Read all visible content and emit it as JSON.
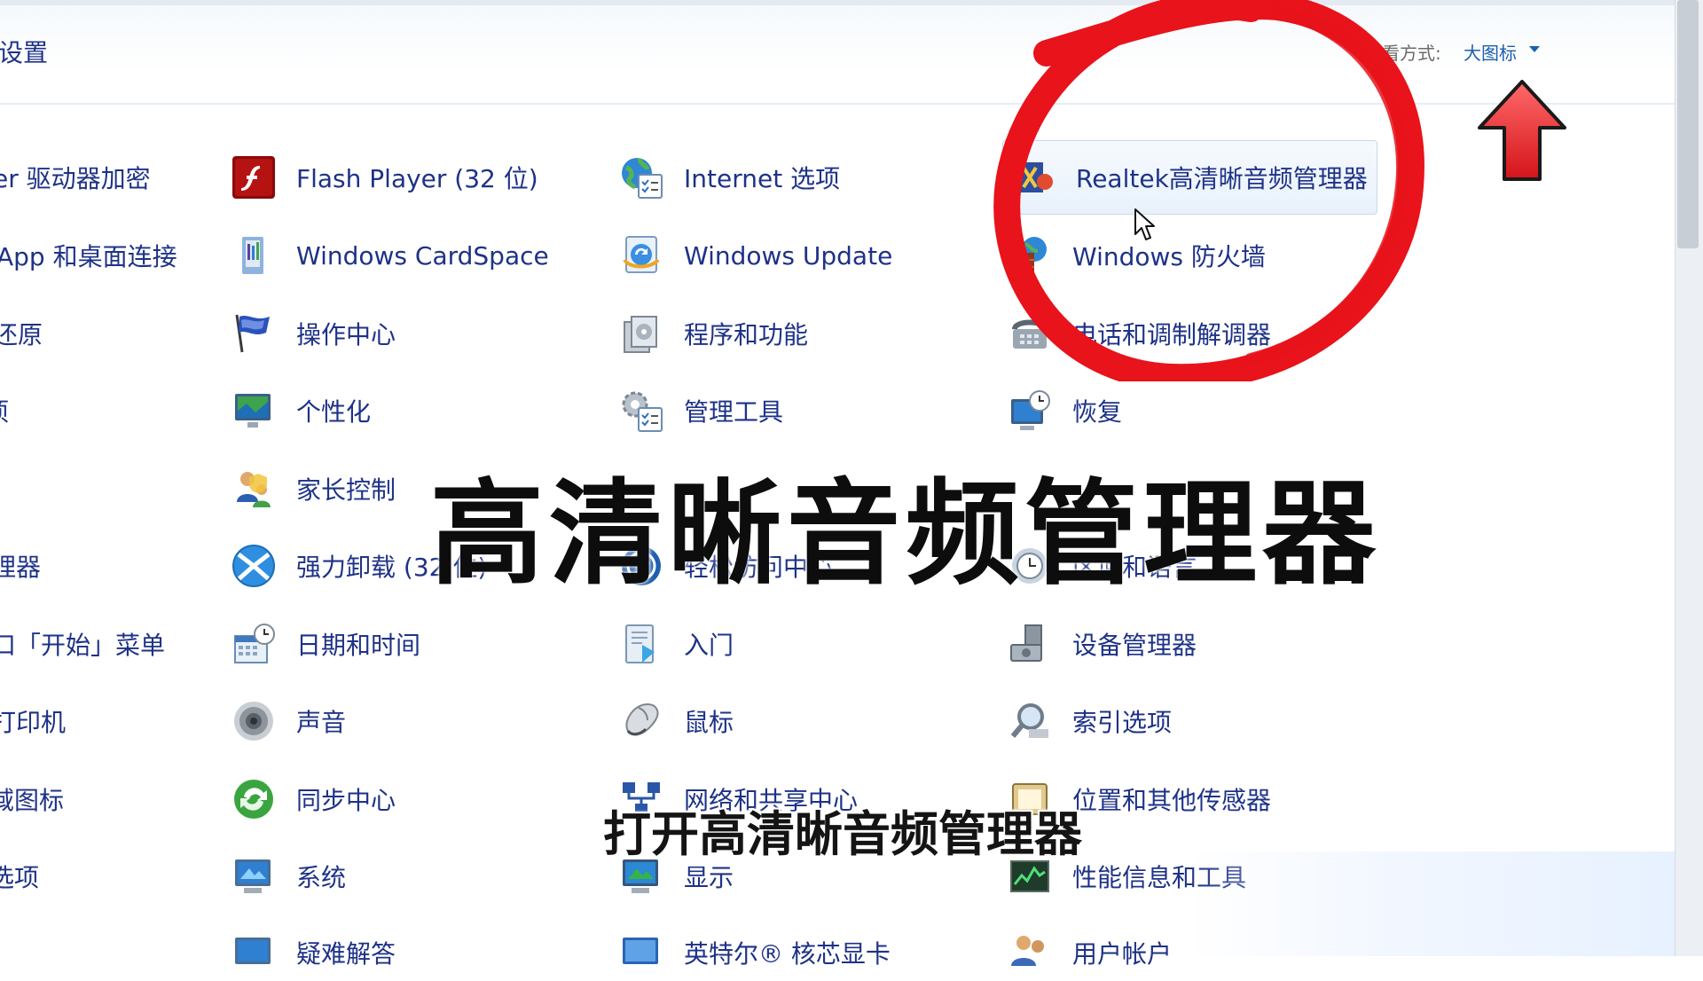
{
  "header": {
    "title": "设置",
    "view_label": "查看方式:",
    "view_value": "大图标"
  },
  "columns": [
    {
      "items": [
        {
          "label": "er 驱动器加密",
          "icon": "bitlocker-icon"
        },
        {
          "label": "App 和桌面连接",
          "icon": "remoteapp-icon"
        },
        {
          "label": "还原",
          "icon": "restore-icon"
        },
        {
          "label": "项",
          "icon": "folder-options-icon"
        },
        {
          "label": "",
          "icon": "blank"
        },
        {
          "label": "理器",
          "icon": "credential-icon"
        },
        {
          "label": "口「开始」菜单",
          "icon": "taskbar-icon"
        },
        {
          "label": "打印机",
          "icon": "printer-icon"
        },
        {
          "label": "域图标",
          "icon": "notification-icon"
        },
        {
          "label": "选项",
          "icon": "options-icon"
        },
        {
          "label": "",
          "icon": "blank"
        }
      ]
    },
    {
      "items": [
        {
          "label": "Flash Player (32 位)",
          "icon": "flash-icon"
        },
        {
          "label": "Windows CardSpace",
          "icon": "cardspace-icon"
        },
        {
          "label": "操作中心",
          "icon": "flag-icon"
        },
        {
          "label": "个性化",
          "icon": "personalize-icon"
        },
        {
          "label": "家长控制",
          "icon": "parental-icon"
        },
        {
          "label": "强力卸载 (32 位)",
          "icon": "uninstall-icon"
        },
        {
          "label": "日期和时间",
          "icon": "datetime-icon"
        },
        {
          "label": "声音",
          "icon": "speaker-icon"
        },
        {
          "label": "同步中心",
          "icon": "sync-icon"
        },
        {
          "label": "系统",
          "icon": "system-icon"
        },
        {
          "label": "疑难解答",
          "icon": "troubleshoot-icon"
        }
      ]
    },
    {
      "items": [
        {
          "label": "Internet 选项",
          "icon": "internet-icon"
        },
        {
          "label": "Windows Update",
          "icon": "update-icon"
        },
        {
          "label": "程序和功能",
          "icon": "programs-icon"
        },
        {
          "label": "管理工具",
          "icon": "admin-tools-icon"
        },
        {
          "label": "",
          "icon": "blank"
        },
        {
          "label": "轻松访问中心",
          "icon": "ease-access-icon"
        },
        {
          "label": "入门",
          "icon": "getting-started-icon"
        },
        {
          "label": "鼠标",
          "icon": "mouse-icon"
        },
        {
          "label": "网络和共享中心",
          "icon": "network-icon"
        },
        {
          "label": "显示",
          "icon": "display-icon"
        },
        {
          "label": "英特尔® 核芯显卡",
          "icon": "intel-icon"
        }
      ]
    },
    {
      "items": [
        {
          "label": "Realtek高清晰音频管理器",
          "icon": "realtek-icon"
        },
        {
          "label": "Windows 防火墙",
          "icon": "firewall-icon"
        },
        {
          "label": "电话和调制解调器",
          "icon": "phone-icon"
        },
        {
          "label": "恢复",
          "icon": "recovery-icon"
        },
        {
          "label": "",
          "icon": "blank"
        },
        {
          "label": "区域和语言",
          "icon": "region-icon"
        },
        {
          "label": "设备管理器",
          "icon": "device-manager-icon"
        },
        {
          "label": "索引选项",
          "icon": "indexing-icon"
        },
        {
          "label": "位置和其他传感器",
          "icon": "sensor-icon"
        },
        {
          "label": "性能信息和工具",
          "icon": "performance-icon"
        },
        {
          "label": "用户帐户",
          "icon": "user-accounts-icon"
        }
      ]
    }
  ],
  "overlay": {
    "title": "高清晰音频管理器",
    "subtitle": "打开高清晰音频管理器"
  },
  "colors": {
    "link": "#1e3287",
    "annotation_red": "#e8131b"
  }
}
